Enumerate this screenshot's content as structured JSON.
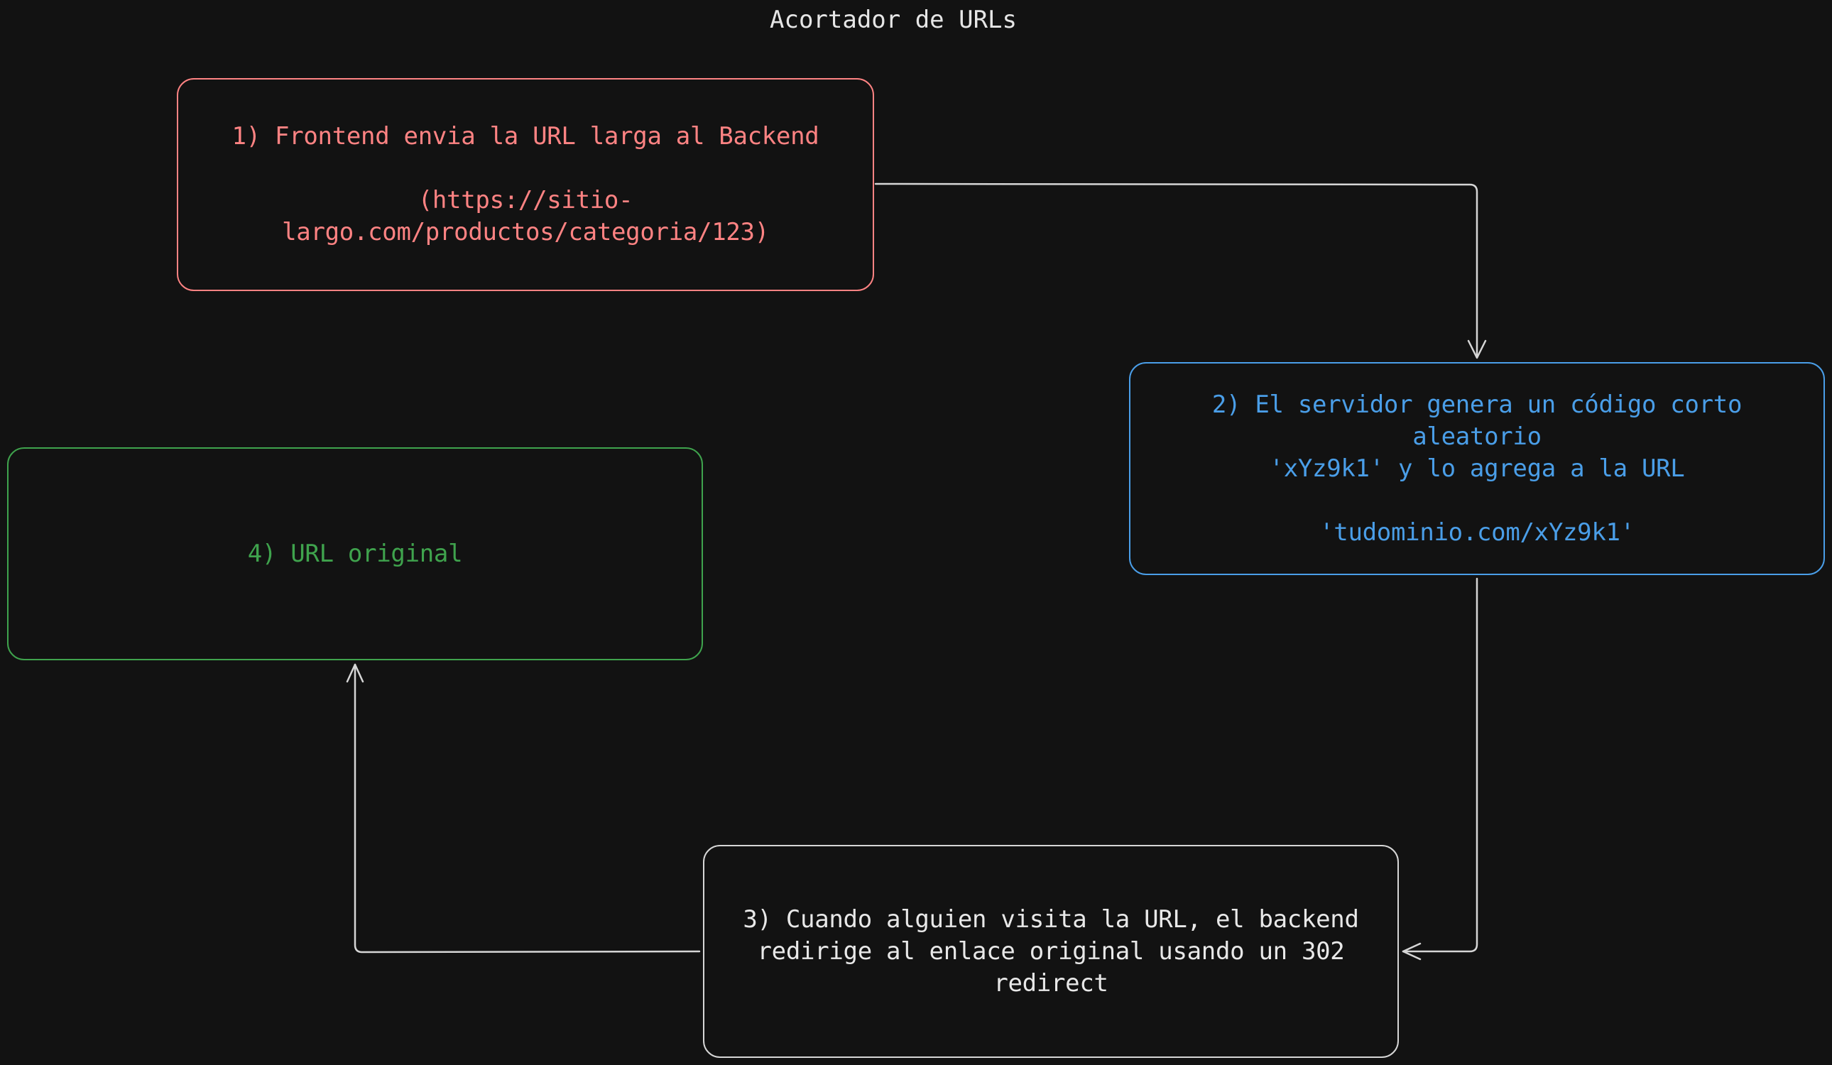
{
  "title": "Acortador de URLs",
  "colors": {
    "background": "#121212",
    "step1": "#ff8383",
    "step2": "#4a9ee8",
    "step3": "#d6d6d6",
    "step4": "#3fa34d",
    "arrows": "#d6d6d6"
  },
  "nodes": {
    "step1": "1) Frontend envia la URL larga al Backend\n\n(https://sitio-\nlargo.com/productos/categoria/123)",
    "step2": "2) El servidor genera un código corto aleatorio\n'xYz9k1' y lo agrega a la URL\n\n'tudominio.com/xYz9k1'",
    "step3": "3) Cuando alguien visita la URL, el backend\nredirige al enlace original usando un 302\nredirect",
    "step4": "4) URL original"
  },
  "edges": [
    {
      "from": "step1",
      "to": "step2"
    },
    {
      "from": "step2",
      "to": "step3"
    },
    {
      "from": "step3",
      "to": "step4"
    }
  ]
}
